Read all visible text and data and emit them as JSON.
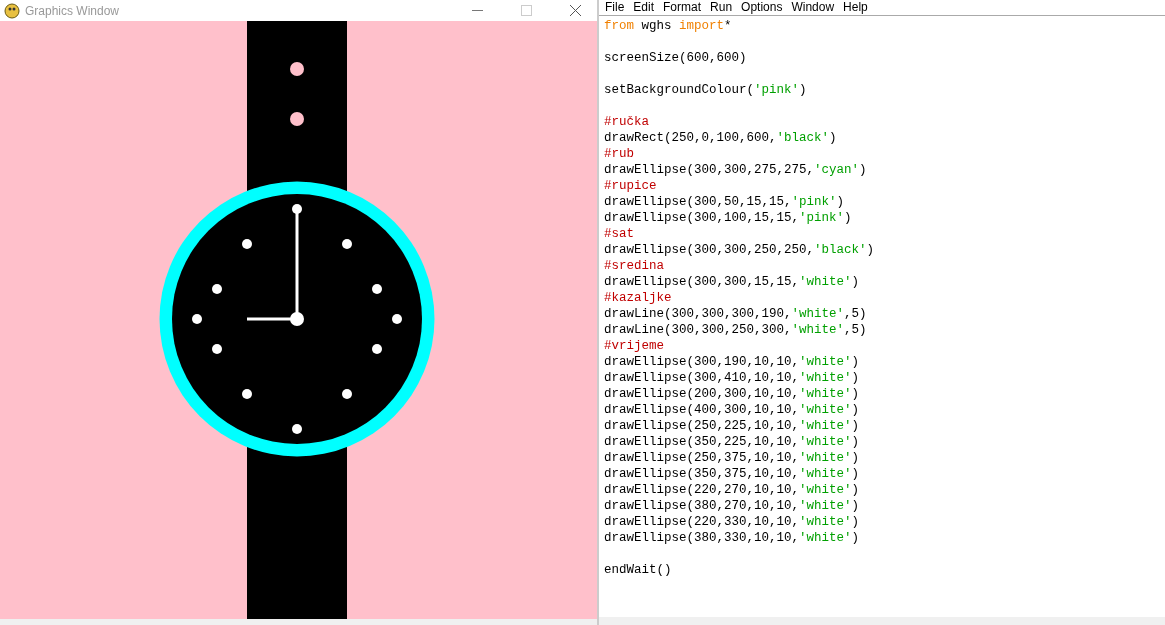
{
  "graphics_window": {
    "title": "Graphics Window"
  },
  "editor": {
    "menu": [
      "File",
      "Edit",
      "Format",
      "Run",
      "Options",
      "Window",
      "Help"
    ],
    "blocks": [
      {
        "lines": [
          [
            {
              "kind": "keyword",
              "text": "from"
            },
            {
              "kind": "plain",
              "text": " wghs "
            },
            {
              "kind": "keyword",
              "text": "import"
            },
            {
              "kind": "plain",
              "text": "*"
            }
          ]
        ]
      },
      {
        "lines": [
          [
            {
              "kind": "plain",
              "text": "screenSize(600,600)"
            }
          ]
        ]
      },
      {
        "lines": [
          [
            {
              "kind": "plain",
              "text": "setBackgroundColour("
            },
            {
              "kind": "string",
              "text": "'pink'"
            },
            {
              "kind": "plain",
              "text": ")"
            }
          ]
        ]
      },
      {
        "lines": [
          [
            {
              "kind": "comment",
              "text": "#ručka"
            }
          ],
          [
            {
              "kind": "plain",
              "text": "drawRect(250,0,100,600,"
            },
            {
              "kind": "string",
              "text": "'black'"
            },
            {
              "kind": "plain",
              "text": ")"
            }
          ],
          [
            {
              "kind": "comment",
              "text": "#rub"
            }
          ],
          [
            {
              "kind": "plain",
              "text": "drawEllipse(300,300,275,275,"
            },
            {
              "kind": "string",
              "text": "'cyan'"
            },
            {
              "kind": "plain",
              "text": ")"
            }
          ],
          [
            {
              "kind": "comment",
              "text": "#rupice"
            }
          ],
          [
            {
              "kind": "plain",
              "text": "drawEllipse(300,50,15,15,"
            },
            {
              "kind": "string",
              "text": "'pink'"
            },
            {
              "kind": "plain",
              "text": ")"
            }
          ],
          [
            {
              "kind": "plain",
              "text": "drawEllipse(300,100,15,15,"
            },
            {
              "kind": "string",
              "text": "'pink'"
            },
            {
              "kind": "plain",
              "text": ")"
            }
          ],
          [
            {
              "kind": "comment",
              "text": "#sat"
            }
          ],
          [
            {
              "kind": "plain",
              "text": "drawEllipse(300,300,250,250,"
            },
            {
              "kind": "string",
              "text": "'black'"
            },
            {
              "kind": "plain",
              "text": ")"
            }
          ],
          [
            {
              "kind": "comment",
              "text": "#sredina"
            }
          ],
          [
            {
              "kind": "plain",
              "text": "drawEllipse(300,300,15,15,"
            },
            {
              "kind": "string",
              "text": "'white'"
            },
            {
              "kind": "plain",
              "text": ")"
            }
          ],
          [
            {
              "kind": "comment",
              "text": "#kazaljke"
            }
          ],
          [
            {
              "kind": "plain",
              "text": "drawLine(300,300,300,190,"
            },
            {
              "kind": "string",
              "text": "'white'"
            },
            {
              "kind": "plain",
              "text": ",5)"
            }
          ],
          [
            {
              "kind": "plain",
              "text": "drawLine(300,300,250,300,"
            },
            {
              "kind": "string",
              "text": "'white'"
            },
            {
              "kind": "plain",
              "text": ",5)"
            }
          ],
          [
            {
              "kind": "comment",
              "text": "#vrijeme"
            }
          ],
          [
            {
              "kind": "plain",
              "text": "drawEllipse(300,190,10,10,"
            },
            {
              "kind": "string",
              "text": "'white'"
            },
            {
              "kind": "plain",
              "text": ")"
            }
          ],
          [
            {
              "kind": "plain",
              "text": "drawEllipse(300,410,10,10,"
            },
            {
              "kind": "string",
              "text": "'white'"
            },
            {
              "kind": "plain",
              "text": ")"
            }
          ],
          [
            {
              "kind": "plain",
              "text": "drawEllipse(200,300,10,10,"
            },
            {
              "kind": "string",
              "text": "'white'"
            },
            {
              "kind": "plain",
              "text": ")"
            }
          ],
          [
            {
              "kind": "plain",
              "text": "drawEllipse(400,300,10,10,"
            },
            {
              "kind": "string",
              "text": "'white'"
            },
            {
              "kind": "plain",
              "text": ")"
            }
          ],
          [
            {
              "kind": "plain",
              "text": "drawEllipse(250,225,10,10,"
            },
            {
              "kind": "string",
              "text": "'white'"
            },
            {
              "kind": "plain",
              "text": ")"
            }
          ],
          [
            {
              "kind": "plain",
              "text": "drawEllipse(350,225,10,10,"
            },
            {
              "kind": "string",
              "text": "'white'"
            },
            {
              "kind": "plain",
              "text": ")"
            }
          ],
          [
            {
              "kind": "plain",
              "text": "drawEllipse(250,375,10,10,"
            },
            {
              "kind": "string",
              "text": "'white'"
            },
            {
              "kind": "plain",
              "text": ")"
            }
          ],
          [
            {
              "kind": "plain",
              "text": "drawEllipse(350,375,10,10,"
            },
            {
              "kind": "string",
              "text": "'white'"
            },
            {
              "kind": "plain",
              "text": ")"
            }
          ],
          [
            {
              "kind": "plain",
              "text": "drawEllipse(220,270,10,10,"
            },
            {
              "kind": "string",
              "text": "'white'"
            },
            {
              "kind": "plain",
              "text": ")"
            }
          ],
          [
            {
              "kind": "plain",
              "text": "drawEllipse(380,270,10,10,"
            },
            {
              "kind": "string",
              "text": "'white'"
            },
            {
              "kind": "plain",
              "text": ")"
            }
          ],
          [
            {
              "kind": "plain",
              "text": "drawEllipse(220,330,10,10,"
            },
            {
              "kind": "string",
              "text": "'white'"
            },
            {
              "kind": "plain",
              "text": ")"
            }
          ],
          [
            {
              "kind": "plain",
              "text": "drawEllipse(380,330,10,10,"
            },
            {
              "kind": "string",
              "text": "'white'"
            },
            {
              "kind": "plain",
              "text": ")"
            }
          ]
        ]
      },
      {
        "lines": [
          [
            {
              "kind": "plain",
              "text": "endWait()"
            }
          ]
        ]
      }
    ]
  }
}
